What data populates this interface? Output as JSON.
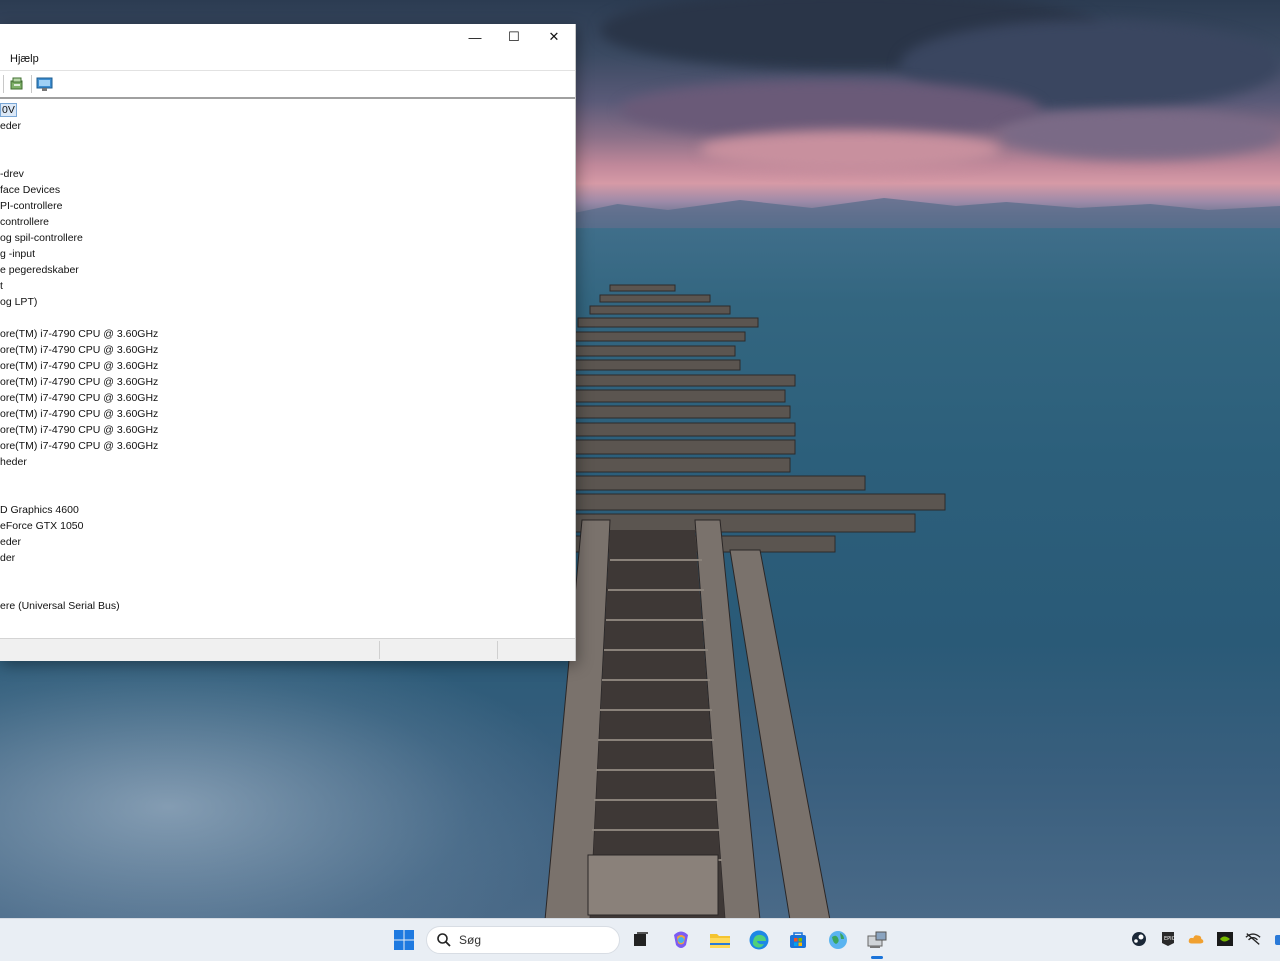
{
  "window": {
    "minimize_glyph": "—",
    "maximize_glyph": "☐",
    "close_glyph": "✕",
    "menu": {
      "help": "Hjælp"
    },
    "toolbar_icons": [
      "update-driver-icon",
      "monitor-scan-icon"
    ],
    "tree_items": [
      "0V",
      "eder",
      "",
      "",
      "-drev",
      "face Devices",
      "PI-controllere",
      "controllere",
      "og spil-controllere",
      "g -input",
      "e pegeredskaber",
      "t",
      "og LPT)",
      "",
      "ore(TM) i7-4790 CPU @ 3.60GHz",
      "ore(TM) i7-4790 CPU @ 3.60GHz",
      "ore(TM) i7-4790 CPU @ 3.60GHz",
      "ore(TM) i7-4790 CPU @ 3.60GHz",
      "ore(TM) i7-4790 CPU @ 3.60GHz",
      "ore(TM) i7-4790 CPU @ 3.60GHz",
      "ore(TM) i7-4790 CPU @ 3.60GHz",
      "ore(TM) i7-4790 CPU @ 3.60GHz",
      "heder",
      "",
      "",
      "D Graphics 4600",
      "eForce GTX 1050",
      "eder",
      "der",
      "",
      "",
      "ere (Universal Serial Bus)"
    ],
    "selected_index": 0
  },
  "taskbar": {
    "search_placeholder": "Søg",
    "pinned_icons": [
      "windows-start-icon",
      "task-view-icon",
      "copilot-icon",
      "file-explorer-icon",
      "edge-browser-icon",
      "microsoft-store-icon",
      "globe-app-icon",
      "device-manager-icon"
    ],
    "tray_icons": [
      "steam-icon",
      "epic-games-icon",
      "cloud-storage-icon",
      "nvidia-icon",
      "network-offline-icon"
    ]
  },
  "colors": {
    "accent": "#1a73d9",
    "selection_border": "#7aa7d6",
    "taskbar_bg": "#e9eef4"
  }
}
